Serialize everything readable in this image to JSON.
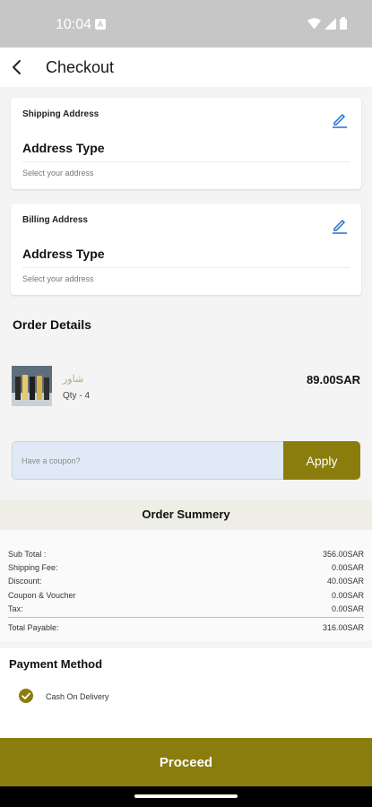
{
  "status_bar": {
    "time": "10:04",
    "notification_glyph": "A",
    "icons": [
      "wifi-icon",
      "signal-icon",
      "battery-icon"
    ]
  },
  "header": {
    "title": "Checkout",
    "back_icon": "chevron-left-icon"
  },
  "shipping": {
    "label": "Shipping Address",
    "type": "Address Type",
    "hint": "Select your address",
    "edit_icon": "pencil-icon"
  },
  "billing": {
    "label": "Billing Address",
    "type": "Address Type",
    "hint": "Select your address",
    "edit_icon": "pencil-icon"
  },
  "order": {
    "title": "Order Details",
    "item": {
      "name": "شاور",
      "qty": "Qty - 4",
      "price": "89.00SAR"
    }
  },
  "coupon": {
    "placeholder": "Have a coupon?",
    "apply_label": "Apply"
  },
  "summary": {
    "title": "Order Summery",
    "rows": [
      {
        "label": "Sub Total :",
        "value": "356.00SAR"
      },
      {
        "label": "Shipping Fee:",
        "value": "0.00SAR"
      },
      {
        "label": "Discount:",
        "value": "40.00SAR"
      },
      {
        "label": "Coupon & Voucher",
        "value": "0.00SAR"
      },
      {
        "label": "Tax:",
        "value": "0.00SAR"
      }
    ],
    "total": {
      "label": "Total Payable:",
      "value": "316.00SAR"
    }
  },
  "payment": {
    "title": "Payment Method",
    "option": "Cash On Delivery",
    "selected": true
  },
  "proceed": {
    "label": "Proceed"
  },
  "colors": {
    "accent": "#8a7d0d",
    "status_bar": "#c6c6c6",
    "coupon_bg": "#dfeaf6",
    "edit_icon": "#1e6fd0"
  }
}
